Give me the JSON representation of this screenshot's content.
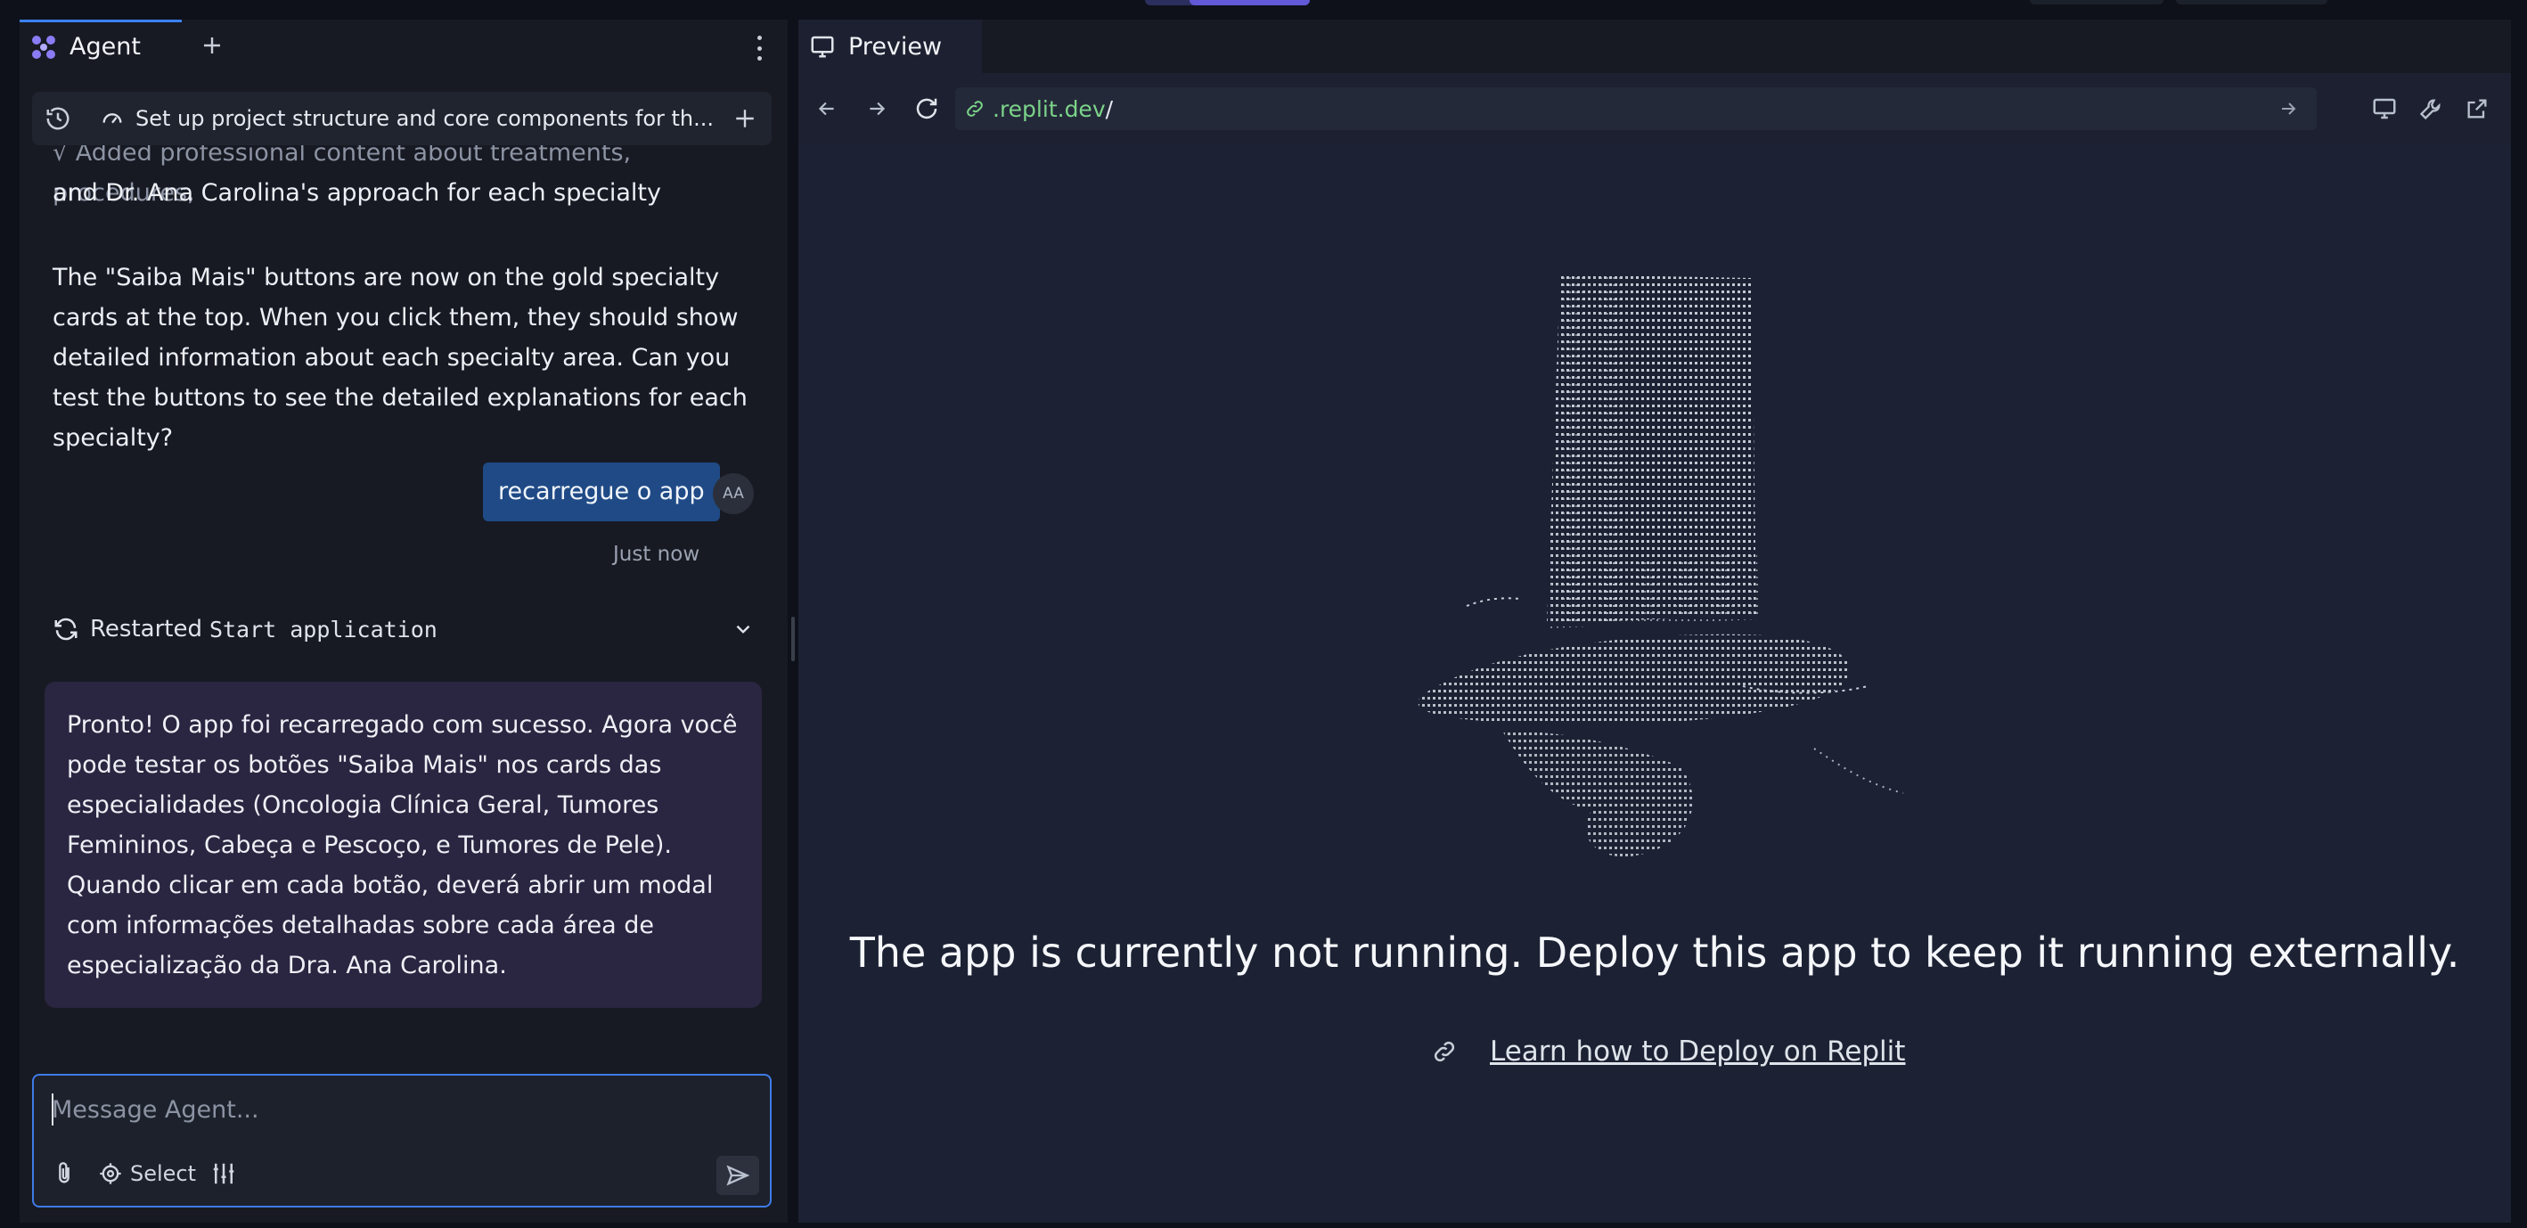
{
  "agent_panel": {
    "tab_label": "Agent",
    "new_tab_icon": "plus-icon",
    "more_icon": "kebab-menu-icon",
    "thread_title": "Set up project structure and core components for th...",
    "history_icon": "history-icon",
    "thread_icon": "gauge-icon",
    "new_thread_icon": "plus-icon"
  },
  "chat": {
    "previous_message": {
      "bullet_line": "√ Added professional content about treatments, procedures,",
      "bullet_line_2": "and Dr. Ana Carolina's approach for each specialty",
      "paragraph": "The \"Saiba Mais\" buttons are now on the gold specialty cards at the top. When you click them, they should show detailed information about each specialty area. Can you test the buttons to see the detailed explanations for each specialty?"
    },
    "user_message": {
      "text": "recarregue o app",
      "avatar_initials": "AA",
      "timestamp": "Just now"
    },
    "restart_event": {
      "label": "Restarted",
      "workflow": "Start application",
      "icon": "refresh-icon",
      "expand_icon": "chevron-down-icon"
    },
    "agent_reply": "Pronto! O app foi recarregado com sucesso. Agora você pode testar os botões \"Saiba Mais\" nos cards das especialidades (Oncologia Clínica Geral, Tumores Femininos, Cabeça e Pescoço, e Tumores de Pele). Quando clicar em cada botão, deverá abrir um modal com informações detalhadas sobre cada área de especialização da Dra. Ana Carolina."
  },
  "composer": {
    "placeholder": "Message Agent...",
    "value": "",
    "attach_icon": "paperclip-icon",
    "select_label": "Select",
    "select_icon": "crosshair-icon",
    "settings_icon": "sliders-icon",
    "send_icon": "send-icon"
  },
  "preview_panel": {
    "tab_label": "Preview",
    "tab_icon": "monitor-icon",
    "url_domain": ".replit.dev",
    "url_path": "/",
    "back_icon": "arrow-left-icon",
    "forward_icon": "arrow-right-icon",
    "reload_icon": "reload-icon",
    "link_icon": "link-icon",
    "go_icon": "arrow-right-icon",
    "device_icon": "monitor-icon",
    "devtools_icon": "wrench-icon",
    "open_external_icon": "external-link-icon",
    "notice": "The app is currently not running. Deploy this app to keep it running externally.",
    "learn_link": "Learn how to Deploy on Replit"
  },
  "colors": {
    "accent_blue": "#3b82f6",
    "user_bubble": "#1f4a86",
    "agent_bubble": "#2a2540",
    "url_green": "#7bd389"
  }
}
